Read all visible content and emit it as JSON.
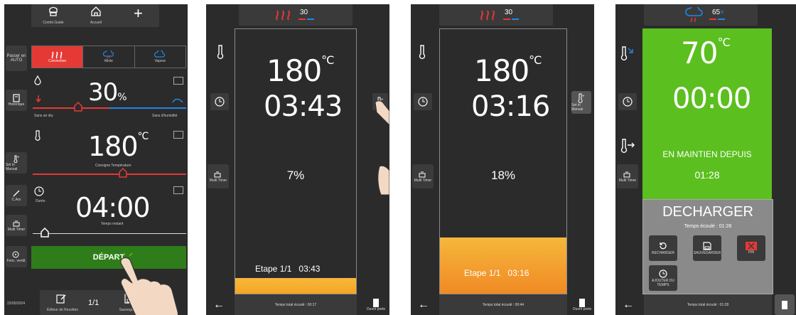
{
  "screen1": {
    "top_nav": {
      "left_label": "Combi Guide",
      "home_label": "Accueil",
      "add_symbol": "+"
    },
    "sidebar": {
      "mode_label_line1": "Passer en",
      "mode_label_line2": "AUTO",
      "history_label": "Historique",
      "probe_label": "Set in Manual",
      "smoker_label": "C.Aro",
      "extra_label": "Multi Timer",
      "fan_label": "Fonc. ventil."
    },
    "modes": {
      "convection": "Convection",
      "mixte": "Mixte",
      "vapeur": "Vapeur"
    },
    "humidity": {
      "value": "30",
      "unit": "%",
      "left_label": "Sans air dry",
      "right_label": "Sans d'humidité"
    },
    "temperature": {
      "value": "180",
      "unit": "°C",
      "caption": "Consigne Température"
    },
    "time": {
      "value": "04:00",
      "caption": "Temps restant",
      "sub_label": "Durée"
    },
    "start_button": "DÉPART",
    "bottom": {
      "date": "22/05/2024",
      "editor_label": "Éditeur de Recettes",
      "page": "1/1",
      "save_label": "Sauvegarder"
    }
  },
  "screen2": {
    "header_value": "30",
    "temperature": {
      "value": "180",
      "unit": "°C"
    },
    "time": "03:43",
    "progress_text": "7%",
    "progress_fraction": 0.07,
    "step_label": "Etape 1/1",
    "step_time": "03:43",
    "left_label": "Multi Timer",
    "bottom_text": "Temps total écoulé : 00:17",
    "right_label": "Ouvrir porte"
  },
  "screen3": {
    "header_value": "30",
    "temperature": {
      "value": "180",
      "unit": "°C"
    },
    "time": "03:16",
    "progress_text": "18%",
    "progress_fraction": 0.18,
    "step_label": "Etape 1/1",
    "step_time": "03:16",
    "left_label": "Multi Timer",
    "right_label": "Set in Manual",
    "bottom_text": "Temps total écoulé : 00:44",
    "right_bottom_label": "Ouvrir porte"
  },
  "screen4": {
    "header_value": "65",
    "temperature": {
      "value": "70",
      "unit": "°C"
    },
    "time": "00:00",
    "maintain_label": "EN MAINTIEN DEPUIS",
    "maintain_time": "01:28",
    "left_label": "Multi Timer",
    "dialog": {
      "title": "DECHARGER",
      "elapsed": "Temps écoulé : 01:28",
      "recharge": "RECHARGER",
      "save": "SAUVEGARDER",
      "end": "FIN",
      "add_time_line1": "AJOUTER DU",
      "add_time_line2": "TEMPS"
    },
    "bottom_text": "Temps total écoulé : 01:28"
  },
  "colors": {
    "bg": "#2b2b2b",
    "red": "#e53935",
    "blue": "#1e88e5",
    "green": "#5bbf1f",
    "orange": "#f5a623"
  }
}
